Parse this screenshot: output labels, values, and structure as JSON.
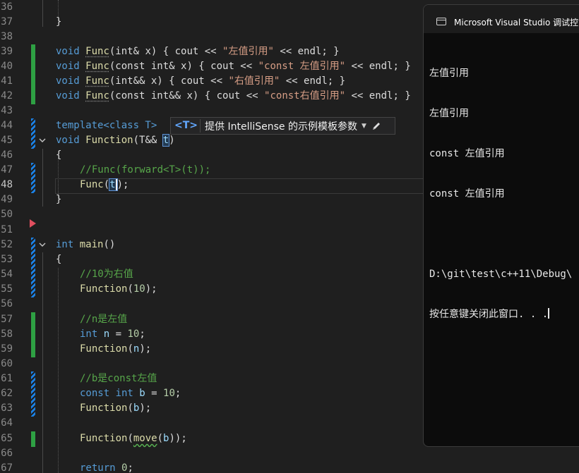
{
  "editor": {
    "lines": [
      {
        "n": "36"
      },
      {
        "n": "37",
        "code": "}"
      },
      {
        "n": "38"
      },
      {
        "n": "39",
        "p1": "void ",
        "p2": "Func",
        "p3": "(int& x) { cout << ",
        "p4": "\"左值引用\"",
        "p5": " << endl; }"
      },
      {
        "n": "40",
        "p1": "void ",
        "p2": "Func",
        "p3": "(const int& x) { cout << ",
        "p4": "\"const 左值引用\"",
        "p5": " << endl; }"
      },
      {
        "n": "41",
        "p1": "void ",
        "p2": "Func",
        "p3": "(int&& x) { cout << ",
        "p4": "\"右值引用\"",
        "p5": " << endl; }"
      },
      {
        "n": "42",
        "p1": "void ",
        "p2": "Func",
        "p3": "(const int&& x) { cout << ",
        "p4": "\"const右值引用\"",
        "p5": " << endl; }"
      },
      {
        "n": "43"
      },
      {
        "n": "44",
        "p1": "template<class T>"
      },
      {
        "n": "45",
        "p1": "void ",
        "p2": "Function",
        "p3": "(T&& ",
        "p4": "t",
        "p5": ")"
      },
      {
        "n": "46",
        "code": "{"
      },
      {
        "n": "47",
        "code": "//Func(forward<T>(t));"
      },
      {
        "n": "48",
        "p1": "Func",
        "p2": "(",
        "p3": "t",
        "p4": ");"
      },
      {
        "n": "49",
        "code": "}"
      },
      {
        "n": "50"
      },
      {
        "n": "51"
      },
      {
        "n": "52",
        "p1": "int ",
        "p2": "main",
        "p3": "()"
      },
      {
        "n": "53",
        "code": "{"
      },
      {
        "n": "54",
        "code": "//10为右值"
      },
      {
        "n": "55",
        "p1": "Function",
        "p2": "(",
        "p3": "10",
        "p4": ");"
      },
      {
        "n": "56"
      },
      {
        "n": "57",
        "code": "//n是左值"
      },
      {
        "n": "58",
        "p1": "int ",
        "p2": "n",
        "p3": " = ",
        "p4": "10",
        "p5": ";"
      },
      {
        "n": "59",
        "p1": "Function",
        "p2": "(",
        "p3": "n",
        "p4": ");"
      },
      {
        "n": "60"
      },
      {
        "n": "61",
        "code": "//b是const左值"
      },
      {
        "n": "62",
        "p1": "const int ",
        "p2": "b",
        "p3": " = ",
        "p4": "10",
        "p5": ";"
      },
      {
        "n": "63",
        "p1": "Function",
        "p2": "(",
        "p3": "b",
        "p4": ");"
      },
      {
        "n": "64"
      },
      {
        "n": "65",
        "p1": "Function",
        "p2": "(",
        "p3": "move",
        "p4": "(",
        "p5": "b",
        "p6": "));"
      },
      {
        "n": "66"
      },
      {
        "n": "67",
        "p1": "return ",
        "p2": "0",
        "p3": ";"
      }
    ]
  },
  "intellisense": {
    "badge": "<T>",
    "label": "提供 IntelliSense 的示例模板参数"
  },
  "console": {
    "title": "Microsoft Visual Studio 调试控",
    "output": [
      "左值引用",
      "左值引用",
      "const 左值引用",
      "const 左值引用",
      "",
      "D:\\git\\test\\c++11\\Debug\\",
      "按任意键关闭此窗口. . ."
    ]
  },
  "colors": {
    "background": "#1f1f1f",
    "keyword": "#569cd6",
    "function": "#dcdcaa",
    "string": "#d69d85",
    "comment": "#57a64a",
    "saved_change": "#2ea043",
    "unsaved_change": "#1b81e5",
    "breakpoint_arrow": "#e04f5f"
  }
}
